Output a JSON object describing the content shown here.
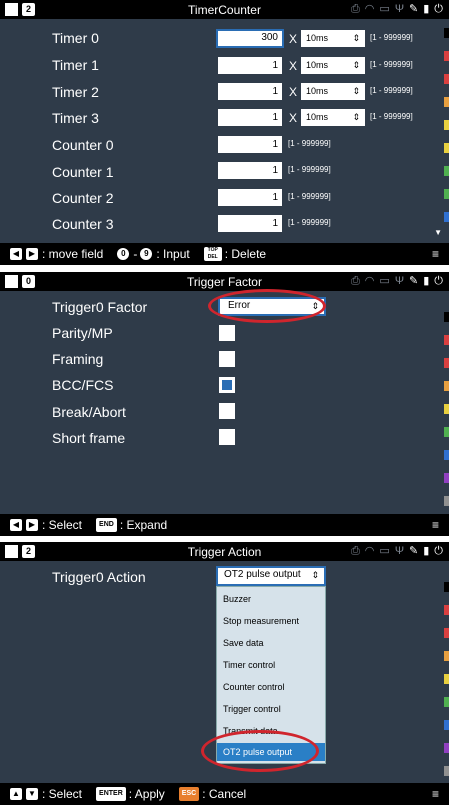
{
  "colors": {
    "panel_bg": "#2f3b49",
    "accent_blue": "#2a6db4",
    "highlight_red": "#d0252d",
    "key_orange": "#e87f2e",
    "sidebar": [
      "#000000",
      "#d94040",
      "#d94040",
      "#e8a040",
      "#e8d040",
      "#e8d040",
      "#50b050",
      "#50b050",
      "#3070d0",
      "#9040c0",
      "#909090",
      "#ffffff"
    ]
  },
  "status_icons": [
    "printer-icon",
    "wifi-icon",
    "network-icon",
    "usb-icon",
    "pen-icon",
    "sd-card-icon",
    "power-icon"
  ],
  "timer_counter": {
    "panel_number": "2",
    "title": "TimerCounter",
    "timers": [
      {
        "label": "Timer 0",
        "value": "300",
        "unit": "10ms",
        "range": "[1 - 999999]"
      },
      {
        "label": "Timer 1",
        "value": "1",
        "unit": "10ms",
        "range": "[1 - 999999]"
      },
      {
        "label": "Timer 2",
        "value": "1",
        "unit": "10ms",
        "range": "[1 - 999999]"
      },
      {
        "label": "Timer 3",
        "value": "1",
        "unit": "10ms",
        "range": "[1 - 999999]"
      }
    ],
    "x_symbol": "X",
    "counters": [
      {
        "label": "Counter 0",
        "value": "1",
        "range": "[1 - 999999]"
      },
      {
        "label": "Counter 1",
        "value": "1",
        "range": "[1 - 999999]"
      },
      {
        "label": "Counter 2",
        "value": "1",
        "range": "[1 - 999999]"
      },
      {
        "label": "Counter 3",
        "value": "1",
        "range": "[1 - 999999]"
      }
    ],
    "bottom": {
      "move_text": ": move field",
      "key_0": "0",
      "key_9": "9",
      "input_text": ": Input",
      "key_del": "TOP DEL",
      "delete_text": ": Delete"
    }
  },
  "trigger_factor": {
    "panel_number": "0",
    "title": "Trigger Factor",
    "factor_label": "Trigger0  Factor",
    "factor_value": "Error",
    "options": [
      {
        "label": "Parity/MP",
        "checked": false
      },
      {
        "label": "Framing",
        "checked": false
      },
      {
        "label": "BCC/FCS",
        "checked": true
      },
      {
        "label": "Break/Abort",
        "checked": false
      },
      {
        "label": "Short frame",
        "checked": false
      }
    ],
    "bottom": {
      "select_text": ": Select",
      "key_end": "END",
      "expand_text": ": Expand"
    }
  },
  "trigger_action": {
    "panel_number": "2",
    "title": "Trigger Action",
    "action_label": "Trigger0  Action",
    "action_value": "OT2 pulse output",
    "dropdown_items": [
      "Buzzer",
      "Stop measurement",
      "Save data",
      "Timer control",
      "Counter control",
      "Trigger control",
      "Transmit data",
      "OT2 pulse output"
    ],
    "bottom": {
      "select_text": ": Select",
      "key_enter": "ENTER",
      "apply_text": ": Apply",
      "key_esc": "ESC",
      "cancel_text": ": Cancel"
    }
  }
}
